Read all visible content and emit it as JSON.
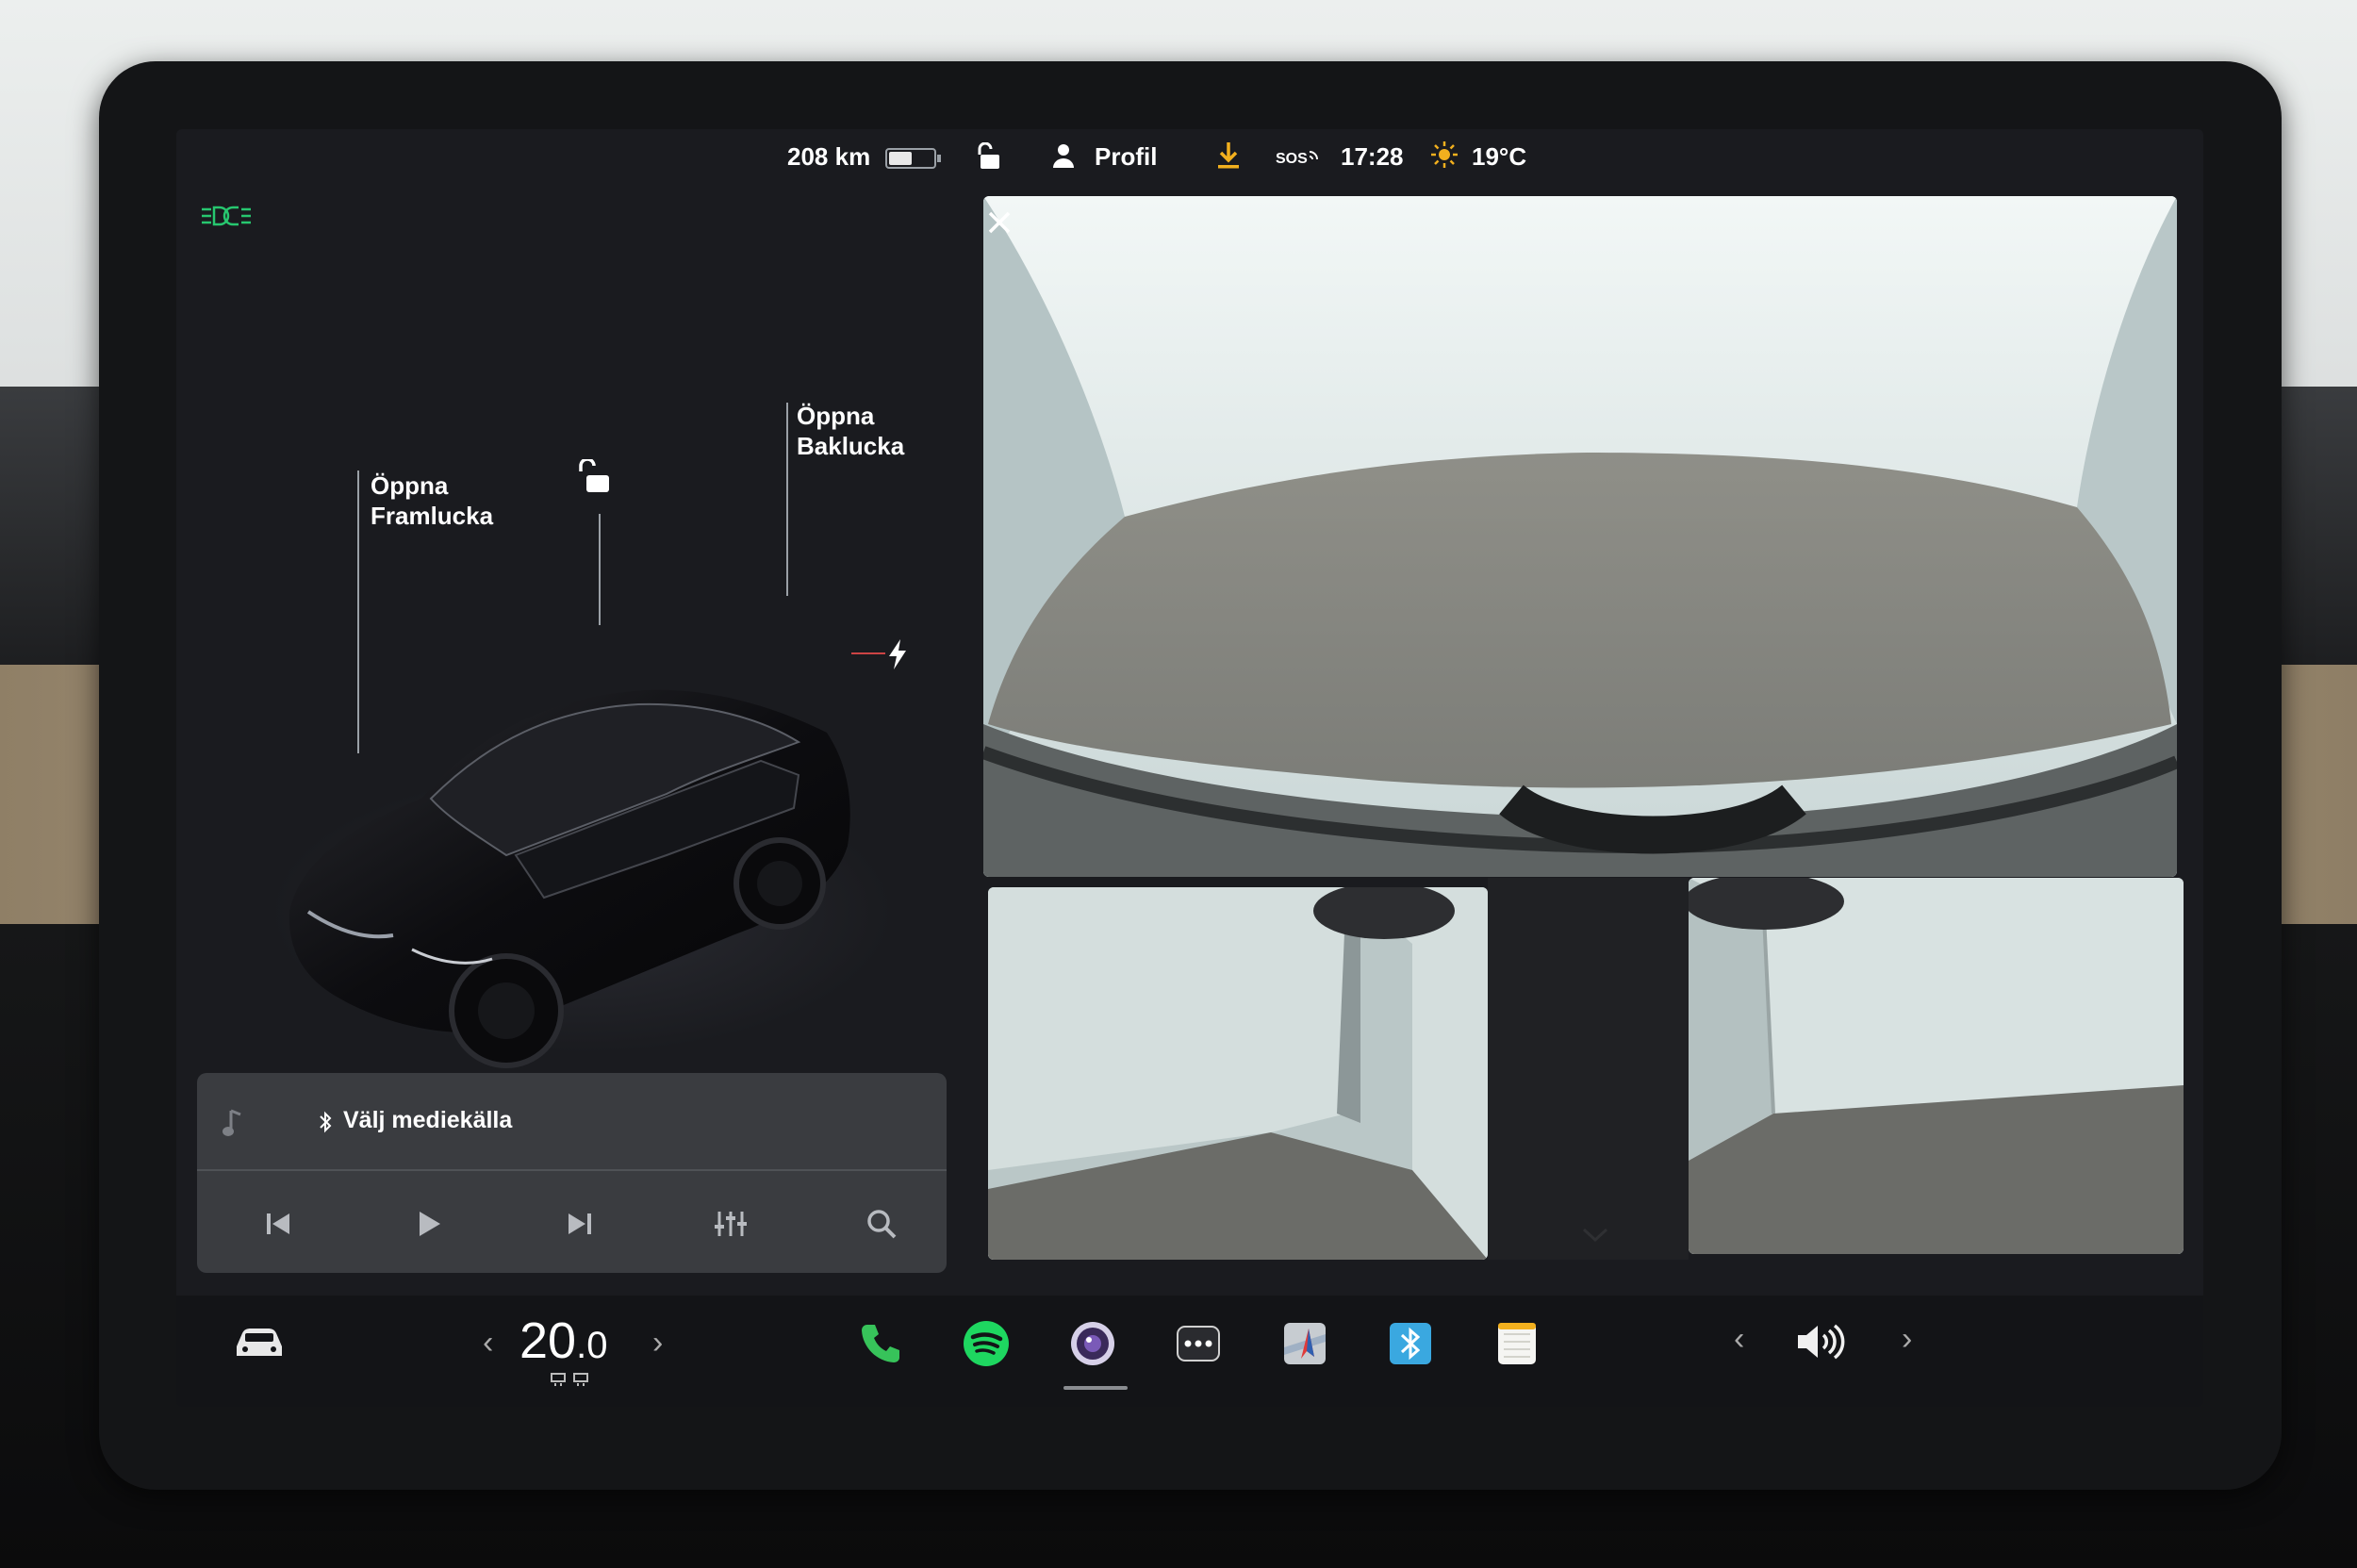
{
  "status_bar": {
    "range": "208 km",
    "battery_level": 0.55,
    "profile_label": "Profil",
    "sos_label": "SOS",
    "time": "17:28",
    "temperature": "19°C"
  },
  "car_panel": {
    "front_trunk_label": [
      "Öppna",
      "Framlucka"
    ],
    "rear_trunk_label": [
      "Öppna",
      "Baklucka"
    ],
    "lights_color": "#27c76f",
    "car_color": "#0d0d10"
  },
  "media": {
    "source_label": "Välj mediekälla",
    "controls": [
      "previous-track-icon",
      "play-icon",
      "next-track-icon",
      "equalizer-icon",
      "search-icon"
    ]
  },
  "taskbar": {
    "climate_temp_whole": "20",
    "climate_temp_decimal": ".0",
    "apps": [
      "phone",
      "spotify",
      "camera",
      "more",
      "navigation",
      "bluetooth",
      "notes"
    ],
    "accent_phone": "#37c35a",
    "accent_spotify": "#1ed760",
    "accent_bluetooth": "#3aa8e0"
  }
}
